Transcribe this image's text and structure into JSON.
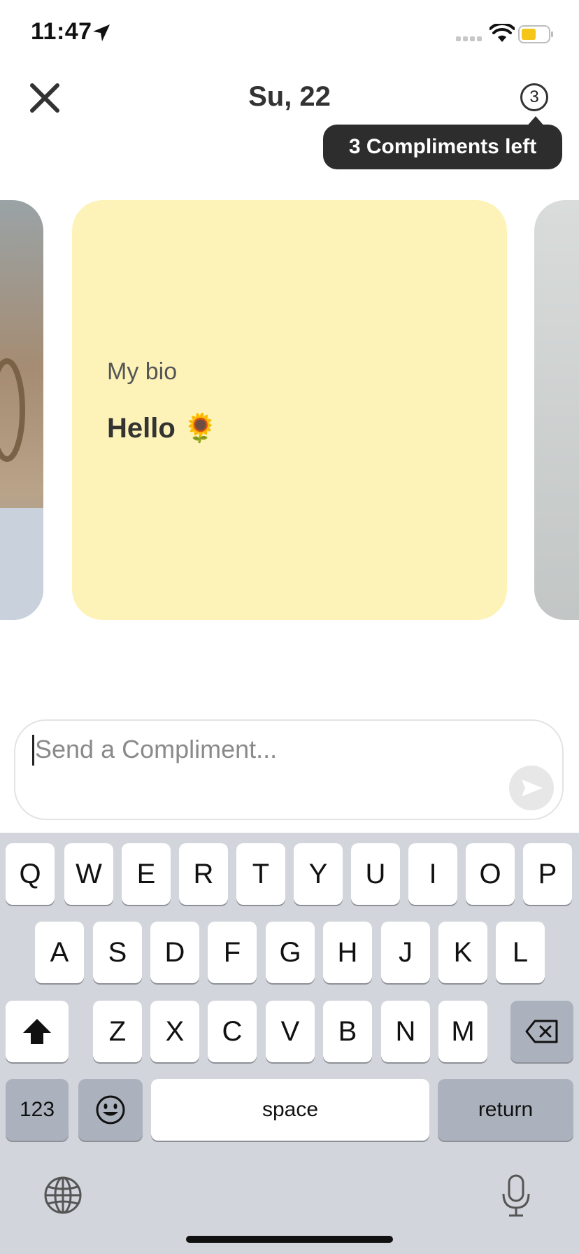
{
  "status_bar": {
    "time": "11:47",
    "icons": [
      "location-arrow-icon",
      "signal-icon",
      "wifi-icon",
      "battery-icon"
    ]
  },
  "header": {
    "title": "Su, 22",
    "counter": "3",
    "tooltip": "3 Compliments left"
  },
  "card": {
    "label": "My bio",
    "text": "Hello 🌻"
  },
  "compose": {
    "placeholder": "Send a Compliment..."
  },
  "keyboard": {
    "row1": [
      "Q",
      "W",
      "E",
      "R",
      "T",
      "Y",
      "U",
      "I",
      "O",
      "P"
    ],
    "row2": [
      "A",
      "S",
      "D",
      "F",
      "G",
      "H",
      "J",
      "K",
      "L"
    ],
    "row3": [
      "Z",
      "X",
      "C",
      "V",
      "B",
      "N",
      "M"
    ],
    "numbers_label": "123",
    "space_label": "space",
    "return_label": "return"
  },
  "colors": {
    "card_bg": "#fdf3b8",
    "tooltip_bg": "#2d2d2d",
    "keyboard_bg": "#d2d5db",
    "battery": "#f5c518"
  }
}
